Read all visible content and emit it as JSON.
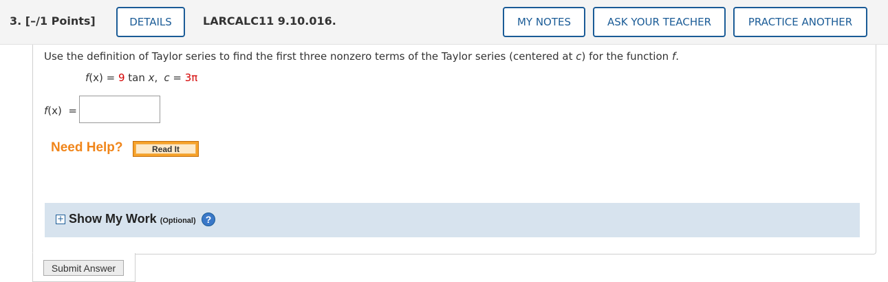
{
  "header": {
    "points": "3.  [–/1 Points]",
    "details_label": "DETAILS",
    "question_id": "LARCALC11 9.10.016.",
    "my_notes_label": "MY NOTES",
    "ask_teacher_label": "ASK YOUR TEACHER",
    "practice_label": "PRACTICE ANOTHER"
  },
  "question": {
    "prompt_part1": "Use the definition of Taylor series to find the first three nonzero terms of the Taylor series (centered at ",
    "prompt_var_c": "c",
    "prompt_part2": ") for the function ",
    "prompt_var_f": "f",
    "prompt_end": ".",
    "eq_fx": "f",
    "eq_x_paren": "(x)",
    "eq_equals": " = ",
    "eq_coef": "9",
    "eq_tan": " tan ",
    "eq_x": "x",
    "eq_comma": ",",
    "eq_c": "c",
    "eq_c_equals": " = ",
    "eq_c_value": "3π",
    "answer_label_f": "f",
    "answer_label_rest": "(x)  =",
    "answer_value": ""
  },
  "help": {
    "need_help_label": "Need Help?",
    "read_it_label": "Read It"
  },
  "show_work": {
    "toggle_symbol": "+",
    "title": "Show My Work",
    "optional_label": "(Optional)",
    "help_symbol": "?"
  },
  "submit_label": "Submit Answer",
  "colors": {
    "accent_blue": "#1a5b96",
    "highlight_red": "#d40000",
    "help_orange": "#f0851a",
    "show_work_bg": "#d7e3ee"
  }
}
